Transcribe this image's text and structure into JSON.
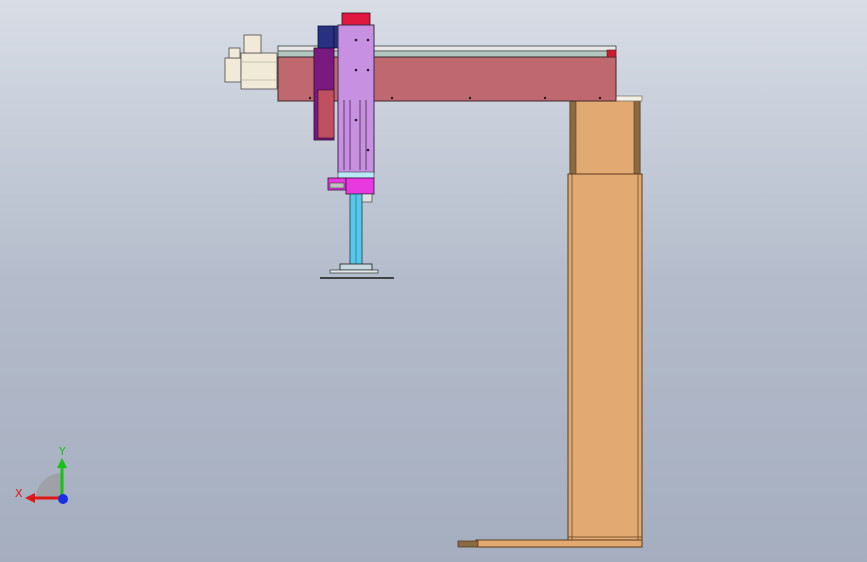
{
  "viewport": {
    "background_top": "#d8dde6",
    "background_bottom": "#a5aebf"
  },
  "triad": {
    "x_label": "X",
    "y_label": "Y",
    "x_color": "#e01818",
    "y_color": "#18c018",
    "z_color": "#1830e0"
  },
  "model": {
    "beam_color": "#c06870",
    "column_color": "#e2aa72",
    "carriage_color": "#c890e0",
    "motor_color": "#f2ead8",
    "shaft_color": "#58c8e8",
    "flange_color": "#e838e0",
    "belt_color": "#7a1a80",
    "cap_color": "#e01840",
    "block_color": "#283080"
  }
}
